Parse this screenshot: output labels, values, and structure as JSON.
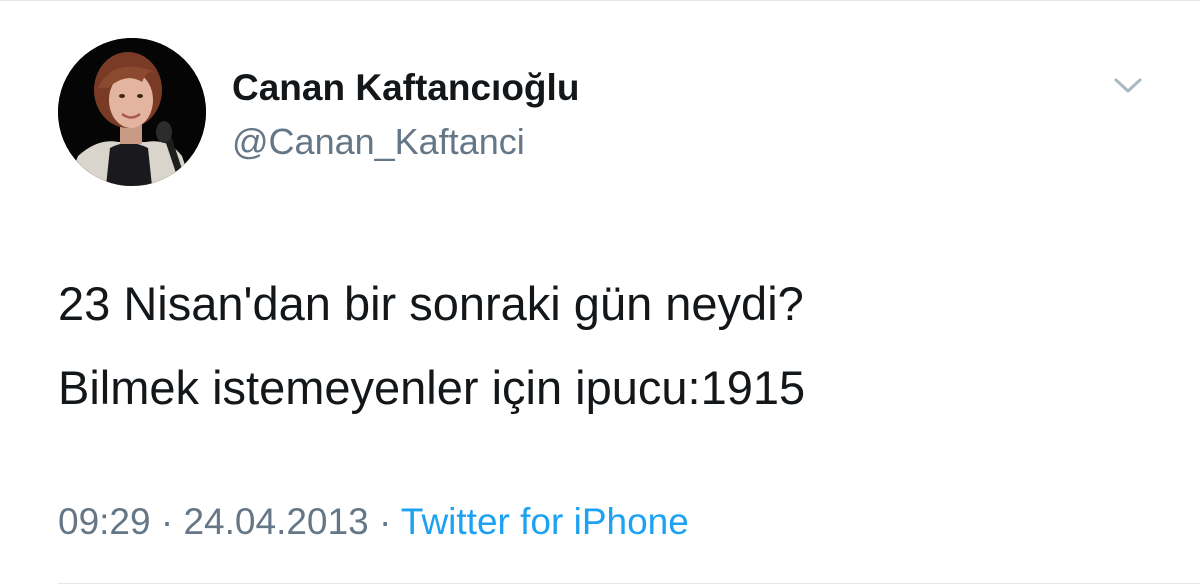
{
  "author": {
    "display_name": "Canan Kaftancıoğlu",
    "handle": "@Canan_Kaftanci"
  },
  "icons": {
    "avatar": "profile-photo",
    "menu": "chevron-down-icon"
  },
  "tweet": {
    "lines": [
      "23 Nisan'dan bir sonraki gün neydi?",
      "Bilmek istemeyenler için ipucu:1915"
    ]
  },
  "meta": {
    "time": "09:29",
    "separator": "·",
    "date": "24.04.2013",
    "source": "Twitter for iPhone"
  },
  "colors": {
    "text": "#14171a",
    "secondary": "#657786",
    "link": "#1da1f2",
    "border": "#e1e8ed"
  }
}
